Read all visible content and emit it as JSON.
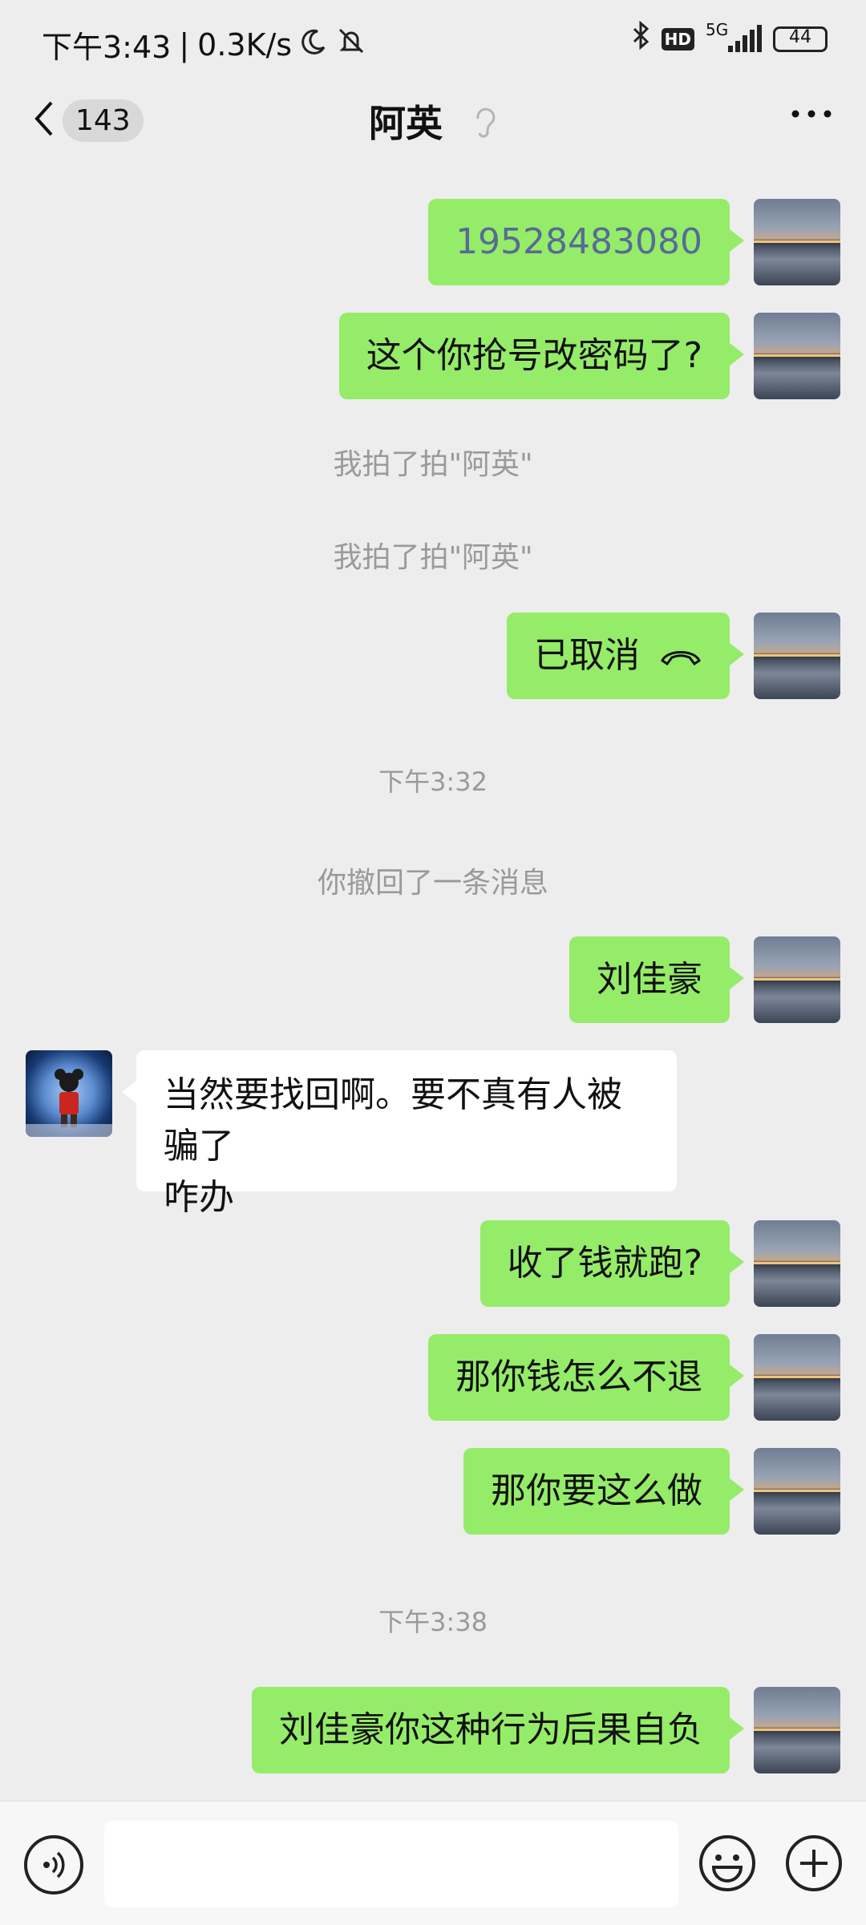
{
  "status": {
    "time": "下午3:43",
    "speed": "0.3K/s",
    "hd": "HD",
    "network": "5G",
    "battery": "44"
  },
  "nav": {
    "unread_count": "143",
    "title": "阿英"
  },
  "messages": [
    {
      "kind": "me",
      "text": "19528483080"
    },
    {
      "kind": "me",
      "text": "这个你抢号改密码了?"
    },
    {
      "kind": "system",
      "text": "我拍了拍\"阿英\""
    },
    {
      "kind": "system",
      "text": "我拍了拍\"阿英\""
    },
    {
      "kind": "me",
      "text": "已取消"
    },
    {
      "kind": "time",
      "text": "下午3:32"
    },
    {
      "kind": "system",
      "text": "你撤回了一条消息"
    },
    {
      "kind": "me",
      "text": "刘佳豪"
    },
    {
      "kind": "them",
      "line1": "当然要找回啊。要不真有人被骗了",
      "line2": "咋办"
    },
    {
      "kind": "me",
      "text": "收了钱就跑?"
    },
    {
      "kind": "me",
      "text": "那你钱怎么不退"
    },
    {
      "kind": "me",
      "text": "那你要这么做"
    },
    {
      "kind": "time",
      "text": "下午3:38"
    },
    {
      "kind": "me",
      "text": "刘佳豪你这种行为后果自负"
    }
  ],
  "input": {
    "placeholder": ""
  },
  "colors": {
    "my_bubble": "#95ec69",
    "their_bubble": "#ffffff",
    "background": "#ededed",
    "system_text": "#9a9a9a",
    "link_text": "#576b95"
  }
}
